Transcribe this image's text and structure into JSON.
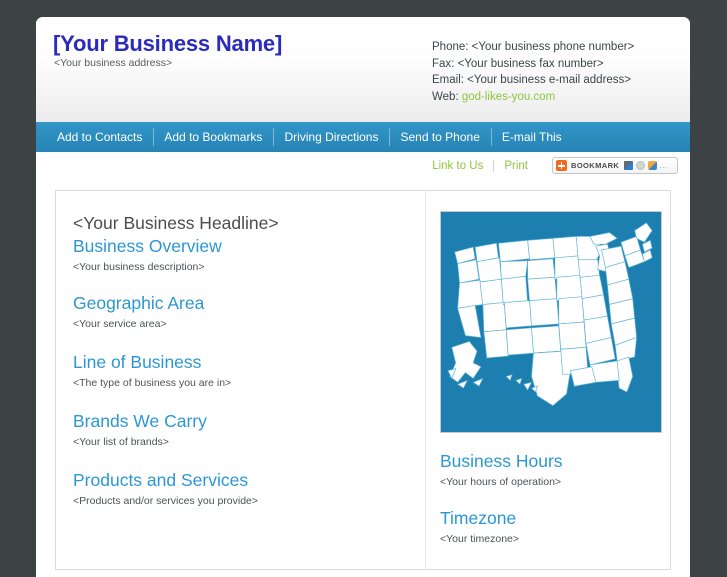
{
  "header": {
    "business_name": "[Your Business Name]",
    "business_address": "<Your business address>",
    "contact": {
      "phone_label": "Phone:",
      "phone_value": "<Your business phone number>",
      "fax_label": "Fax:",
      "fax_value": "<Your business fax number>",
      "email_label": "Email:",
      "email_value": "<Your business e-mail address>",
      "web_label": "Web:",
      "web_value": "god-likes-you.com"
    }
  },
  "nav": {
    "items": [
      {
        "label": "Add to Contacts"
      },
      {
        "label": "Add to Bookmarks"
      },
      {
        "label": "Driving Directions"
      },
      {
        "label": "Send to Phone"
      },
      {
        "label": "E-mail This"
      }
    ]
  },
  "utility": {
    "link_to_us": "Link to Us",
    "print": "Print",
    "bookmark_widget": {
      "label": "BOOKMARK",
      "more": "…"
    }
  },
  "main": {
    "headline": "<Your Business Headline>",
    "left_sections": [
      {
        "title": "Business Overview",
        "body": "<Your business description>"
      },
      {
        "title": "Geographic Area",
        "body": "<Your service area>"
      },
      {
        "title": "Line of Business",
        "body": "<The type of business you are in>"
      },
      {
        "title": "Brands We Carry",
        "body": "<Your list of brands>"
      },
      {
        "title": "Products and Services",
        "body": "<Products and/or services you provide>"
      }
    ],
    "right_sections": [
      {
        "title": "Business Hours",
        "body": "<Your hours of operation>"
      },
      {
        "title": "Timezone",
        "body": "<Your timezone>"
      }
    ],
    "map_alt": "united-states-map"
  },
  "colors": {
    "page_background": "#3d4245",
    "nav_blue": "#2c8cbe",
    "heading_blue": "#2b97d4",
    "link_green": "#8dc63f",
    "business_name_blue": "#2b2bbb",
    "map_blue": "#1d7fb0",
    "bookmark_orange": "#f06a1e"
  }
}
